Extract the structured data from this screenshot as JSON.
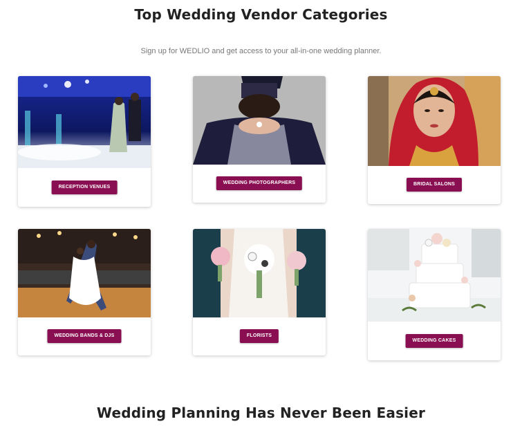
{
  "header": {
    "title": "Top Wedding Vendor Categories",
    "subtitle": "Sign up for WEDLIO and get access to your all-in-one wedding planner."
  },
  "categories": [
    {
      "label": "RECEPTION VENUES",
      "image": "reception-venue-photo"
    },
    {
      "label": "WEDDING PHOTOGRAPHERS",
      "image": "wedding-photographer-photo"
    },
    {
      "label": "BRIDAL SALONS",
      "image": "bridal-salon-photo"
    },
    {
      "label": "WEDDING BANDS & DJS",
      "image": "band-dj-photo"
    },
    {
      "label": "FLORISTS",
      "image": "florist-photo"
    },
    {
      "label": "WEDDING CAKES",
      "image": "wedding-cake-photo"
    }
  ],
  "footer_section": {
    "title": "Wedding Planning Has Never Been Easier"
  },
  "colors": {
    "button": "#8a0f52",
    "title": "#222222",
    "subtitle": "#777777"
  }
}
